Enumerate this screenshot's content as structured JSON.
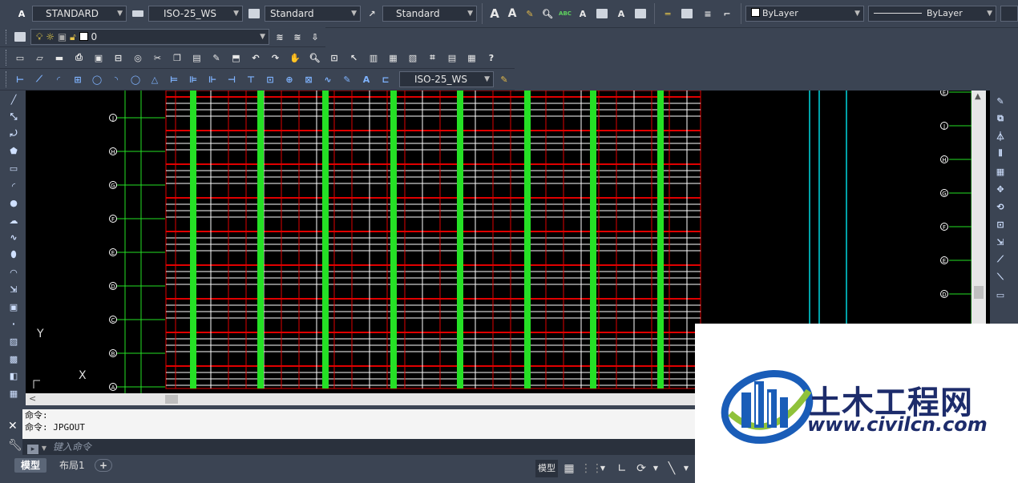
{
  "styles_toolbar": {
    "text_style": "STANDARD",
    "dim_style": "ISO-25_WS",
    "table_style": "Standard",
    "multileader_style": "Standard",
    "color": "ByLayer",
    "linetype": "ByLayer"
  },
  "layers_toolbar": {
    "current_layer": "0"
  },
  "dimension_toolbar": {
    "dim_style": "ISO-25_WS",
    "buttons": [
      "linear",
      "aligned",
      "arc-length",
      "ordinate",
      "radius",
      "jogged",
      "diameter",
      "angular",
      "quick-dim",
      "baseline",
      "continue",
      "dim-space",
      "dim-break",
      "tolerance",
      "center-mark",
      "inspection",
      "jogged-linear",
      "dim-edit",
      "dim-text-edit",
      "dim-update"
    ]
  },
  "standard_toolbar": {
    "buttons": [
      "qnew",
      "open",
      "save",
      "plot",
      "plot-preview",
      "publish",
      "3d-dwf",
      "cut",
      "copy",
      "paste",
      "match-prop",
      "block-editor",
      "undo",
      "redo",
      "pan",
      "zoom-realtime",
      "zoom-window",
      "zoom-previous",
      "properties",
      "design-center",
      "tool-palettes",
      "sheet-set",
      "markup",
      "calculator",
      "help"
    ]
  },
  "drawing": {
    "grid_labels": [
      "J",
      "H",
      "G",
      "F",
      "E",
      "D",
      "C",
      "B",
      "A"
    ],
    "right_labels": [
      "E",
      "J",
      "H",
      "G",
      "F",
      "E",
      "D"
    ],
    "ucs_y": "Y",
    "ucs_x": "X"
  },
  "command": {
    "history": [
      "命令:",
      "命令: JPGOUT"
    ],
    "placeholder": "键入命令",
    "close": "✕"
  },
  "tabs": {
    "model": "模型",
    "layout1": "布局1",
    "add": "+"
  },
  "status": {
    "model_label": "模型",
    "grid_icon": "grid-icon",
    "snap_icon": "snap-icon"
  },
  "watermark": {
    "title": "土木工程网",
    "url": "www.civilcn.com"
  },
  "colors": {
    "ui_bg": "#3b4453",
    "canvas": "#000000",
    "red_lines": "#e00000",
    "green_cols": "#25e025",
    "cyan_lines": "#00d8e0",
    "brand_blue": "#1a5db8",
    "brand_dark": "#1d2c6b"
  }
}
